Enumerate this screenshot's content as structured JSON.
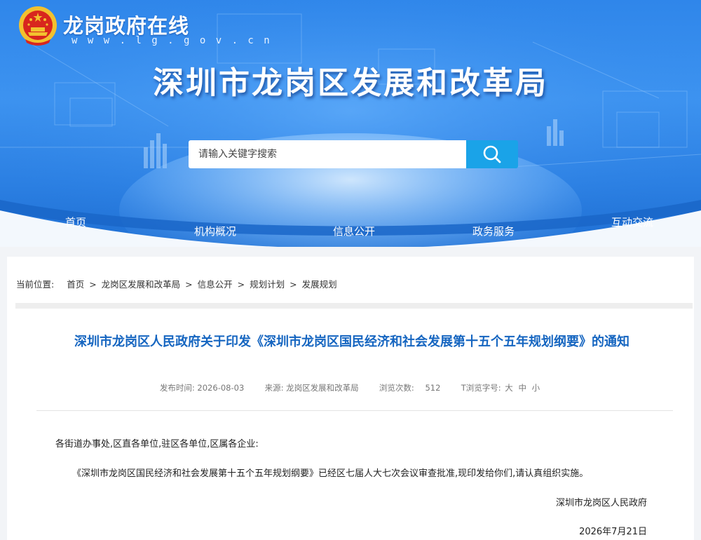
{
  "header": {
    "site_name": "龙岗政府在线",
    "site_url": "w w w . l g . g o v . c n",
    "agency_title": "深圳市龙岗区发展和改革局",
    "search_placeholder": "请输入关键字搜索"
  },
  "nav": {
    "home": "首页",
    "org": "机构概况",
    "info": "信息公开",
    "service": "政务服务",
    "interact": "互动交流"
  },
  "breadcrumb": {
    "prefix": "当前位置:",
    "items": [
      "首页",
      "龙岗区发展和改革局",
      "信息公开",
      "规划计划",
      "发展规划"
    ],
    "separator": ">"
  },
  "article": {
    "title": "深圳市龙岗区人民政府关于印发《深圳市龙岗区国民经济和社会发展第十五个五年规划纲要》的通知",
    "meta": {
      "date_label": "发布时间:",
      "date": "2026-08-03",
      "source_label": "来源:",
      "source": "龙岗区发展和改革局",
      "views_label": "浏览次数:",
      "views": "512",
      "font_label": "T浏览字号:",
      "size_large": "大",
      "size_medium": "中",
      "size_small": "小"
    },
    "salutation": "各街道办事处,区直各单位,驻区各单位,区属各企业:",
    "body": "《深圳市龙岗区国民经济和社会发展第十五个五年规划纲要》已经区七届人大七次会议审查批准,现印发给你们,请认真组织实施。",
    "signature": "深圳市龙岗区人民政府",
    "sign_date": "2026年7月21日"
  },
  "colors": {
    "banner_blue": "#2f86ea",
    "search_button": "#1aa3e8",
    "title_blue": "#1565c0"
  }
}
